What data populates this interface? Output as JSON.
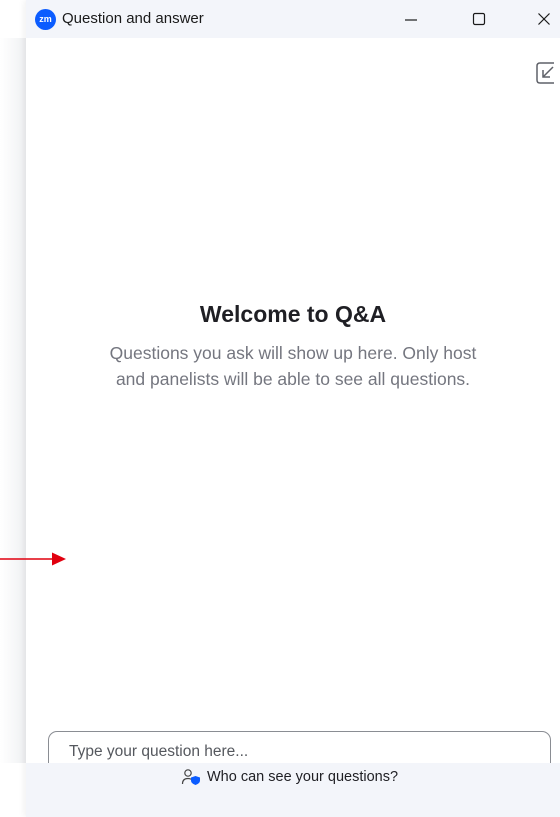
{
  "window": {
    "title": "Question and answer",
    "logo_text": "zm",
    "brand_color": "#0b5cff"
  },
  "welcome": {
    "title": "Welcome to Q&A",
    "description": "Questions you ask will show up here. Only host and panelists will be able to see all questions."
  },
  "input": {
    "value": "",
    "placeholder": "Type your question here..."
  },
  "footer": {
    "link_label": "Who can see your questions?"
  },
  "icons": {
    "minimize": "minimize-icon",
    "maximize": "maximize-icon",
    "close": "close-icon",
    "popout": "popout-icon",
    "visibility": "user-shield-icon"
  },
  "annotation": {
    "arrow_color": "#e1000f"
  }
}
